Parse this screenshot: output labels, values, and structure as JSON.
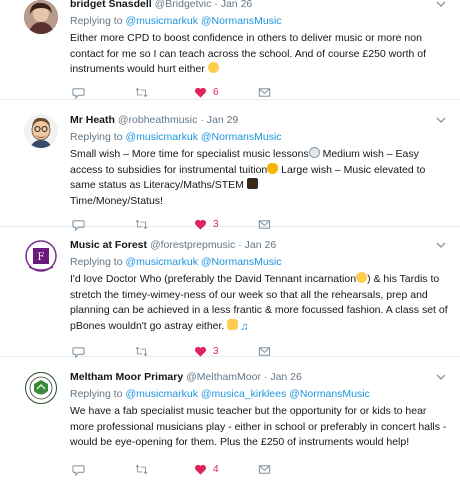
{
  "tweets": [
    {
      "name": "bridget Snasdell",
      "handle": "@Bridgetvic",
      "sep": "·",
      "date": "Jan 26",
      "replying": "Replying to",
      "mentions": [
        "@musicmarkuk",
        "@NormansMusic"
      ],
      "lines": [
        "Either more CPD to boost confidence in others to deliver music or more non",
        "contact for me so I can teach across the school. And of course £250 worth of",
        "instruments would hurt either"
      ],
      "likes": "6"
    },
    {
      "name": "Mr Heath",
      "handle": "@robheathmusic",
      "sep": "·",
      "date": "Jan 29",
      "replying": "Replying to",
      "mentions": [
        "@musicmarkuk",
        "@NormansMusic"
      ],
      "lines": [
        "Small wish – More time for specialist music lessons",
        " Medium wish – Easy",
        "access to subsidies for instrumental tuition",
        " Large wish – Music elevated to",
        "same status as Literacy/Maths/STEM",
        "Time/Money/Status!"
      ],
      "likes": "3"
    },
    {
      "name": "Music at Forest",
      "handle": "@forestprepmusic",
      "sep": "·",
      "date": "Jan 26",
      "replying": "Replying to",
      "mentions": [
        "@musicmarkuk",
        "@NormansMusic"
      ],
      "lines": [
        "I'd love Doctor Who (preferably the David Tennant incarnation",
        ") & his Tardis to",
        "stretch the timey-wimey-ness of our week so that all the rehearsals, prep and",
        "planning can be achieved in a less frantic & more focussed fashion. A class set of",
        "pBones wouldn't go astray either."
      ],
      "likes": "3"
    },
    {
      "name": "Meltham Moor Primary",
      "handle": "@MelthamMoor",
      "sep": "·",
      "date": "Jan 26",
      "replying": "Replying to",
      "mentions": [
        "@musicmarkuk",
        "@musica_kirklees",
        "@NormansMusic"
      ],
      "lines": [
        "We have a fab specialist music teacher but the opportunity for or kids to hear",
        "more professional musicians play - either in school or preferably in concert halls -",
        "would be eye-opening for them.  Plus the £250 of instruments would help!"
      ],
      "likes": "4"
    }
  ],
  "icons": {
    "reply": "reply-icon",
    "retweet": "retweet-icon",
    "like": "heart-icon",
    "dm": "envelope-icon",
    "more": "chevron-down-icon"
  },
  "colors": {
    "link": "#1b95e0",
    "like": "#e0245e",
    "muted": "#657786"
  }
}
